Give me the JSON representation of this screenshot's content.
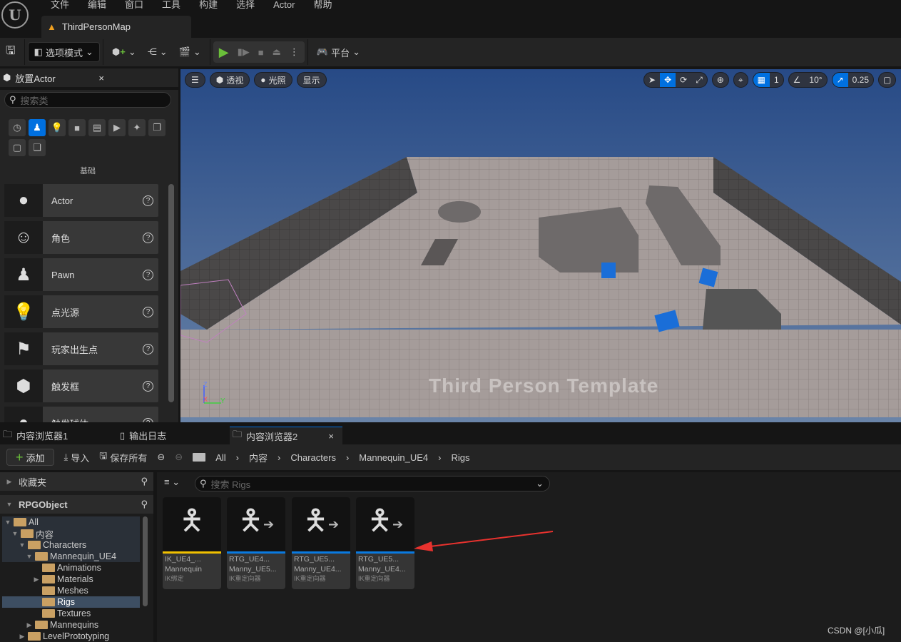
{
  "menu": [
    "文件",
    "编辑",
    "窗口",
    "工具",
    "构建",
    "选择",
    "Actor",
    "帮助"
  ],
  "map_tab": "ThirdPersonMap",
  "toolbar": {
    "mode": "选项模式",
    "platform": "平台"
  },
  "place_actor": {
    "title": "放置Actor",
    "search_placeholder": "搜索类",
    "category": "基础",
    "items": [
      {
        "label": "Actor"
      },
      {
        "label": "角色"
      },
      {
        "label": "Pawn"
      },
      {
        "label": "点光源"
      },
      {
        "label": "玩家出生点"
      },
      {
        "label": "触发框"
      },
      {
        "label": "触发球体"
      }
    ]
  },
  "viewport": {
    "perspective": "透视",
    "lighting": "光照",
    "show": "显示",
    "grid": "1",
    "angle": "10°",
    "scale": "0.25",
    "watermark": "Third Person Template",
    "axes": [
      "Z",
      "X",
      "Y"
    ]
  },
  "bottom_tabs": [
    {
      "label": "内容浏览器1"
    },
    {
      "label": "输出日志"
    },
    {
      "label": "内容浏览器2"
    }
  ],
  "content_toolbar": {
    "add": "添加",
    "import": "导入",
    "save_all": "保存所有",
    "breadcrumb": [
      "All",
      "内容",
      "Characters",
      "Mannequin_UE4",
      "Rigs"
    ]
  },
  "tree": {
    "favorites": "收藏夹",
    "project": "RPGObject",
    "nodes": [
      {
        "label": "All"
      },
      {
        "label": "内容"
      },
      {
        "label": "Characters"
      },
      {
        "label": "Mannequin_UE4"
      },
      {
        "label": "Animations"
      },
      {
        "label": "Materials"
      },
      {
        "label": "Meshes"
      },
      {
        "label": "Rigs"
      },
      {
        "label": "Textures"
      },
      {
        "label": "Mannequins"
      },
      {
        "label": "LevelPrototyping"
      }
    ]
  },
  "search_placeholder": "搜索 Rigs",
  "assets": [
    {
      "name": "IK_UE4_...",
      "sub": "Mannequin",
      "type": "IK绑定",
      "color": "#f0c000"
    },
    {
      "name": "RTG_UE4...",
      "sub": "Manny_UE5...",
      "type": "IK重定向器",
      "color": "#0a7ae0"
    },
    {
      "name": "RTG_UE5...",
      "sub": "Manny_UE4...",
      "type": "IK重定向器",
      "color": "#0a7ae0"
    },
    {
      "name": "RTG_UE5...",
      "sub": "Manny_UE4...",
      "type": "IK重定向器",
      "color": "#0a7ae0"
    }
  ],
  "watermark": "CSDN @[小瓜]",
  "colors": {
    "accent": "#0070e0",
    "arrow": "#e8322e",
    "play": "#6abf3a"
  }
}
